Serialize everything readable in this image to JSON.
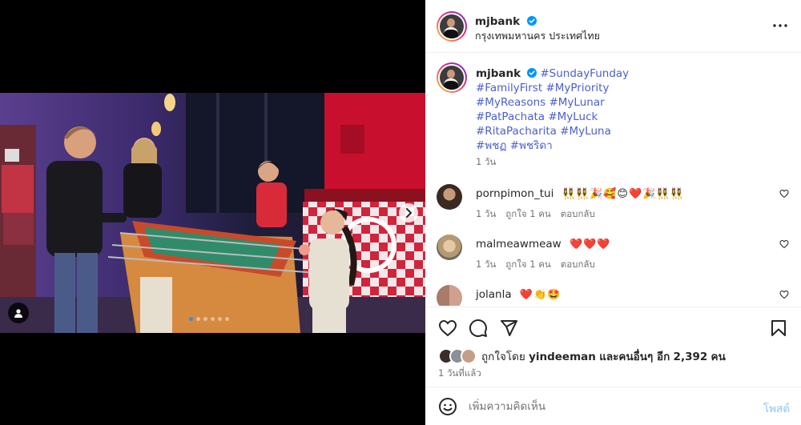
{
  "post": {
    "username": "mjbank",
    "location": "กรุงเทพมหานคร ประเทศไทย",
    "verified": true
  },
  "caption": {
    "username": "mjbank",
    "lines": [
      "#SundayFunday",
      "#FamilyFirst #MyPriority",
      "#MyReasons #MyLunar",
      "#PatPachata #MyLuck",
      "#RitaPacharita #MyLuna",
      "#พชฏ #พชริดา"
    ],
    "time": "1 วัน"
  },
  "comments": [
    {
      "username": "pornpimon_tui",
      "text": "👯‍♀️👯‍♀️🎉🥰😊❤️🎉👯‍♀️👯‍♀️",
      "time": "1 วัน",
      "likes": "ถูกใจ 1 คน",
      "reply": "ตอบกลับ"
    },
    {
      "username": "malmeawmeaw",
      "text": "❤️❤️❤️",
      "time": "1 วัน",
      "likes": "ถูกใจ 1 คน",
      "reply": "ตอบกลับ"
    },
    {
      "username": "jolanla",
      "text": "❤️👏🤩",
      "time": "",
      "likes": "",
      "reply": ""
    }
  ],
  "likes": {
    "prefix": "ถูกใจโดย",
    "user": "yindeeman",
    "middle": "และคนอื่นๆ อีก",
    "count": "2,392",
    "suffix": "คน"
  },
  "time_ago": "1 วันที่แล้ว",
  "composer": {
    "placeholder": "เพิ่มความคิดเห็น",
    "post_label": "โพสต์"
  },
  "carousel": {
    "total": 6,
    "current": 1
  },
  "colors": {
    "accent": "#0095f6",
    "hashtag": "#4a5fd1",
    "heart": "#ed4956"
  },
  "icons": {
    "like": "heart-outline-icon",
    "comment": "comment-bubble-icon",
    "share": "paper-plane-icon",
    "save": "bookmark-icon",
    "more": "more-dots-icon",
    "emoji": "smiley-icon",
    "next": "chevron-right-icon",
    "tags": "user-tag-icon"
  }
}
